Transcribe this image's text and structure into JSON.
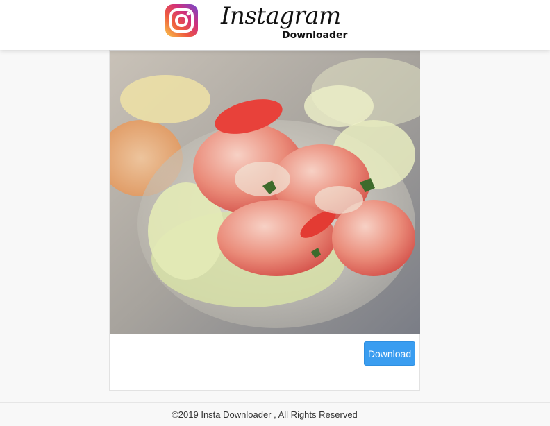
{
  "header": {
    "logo_icon": "instagram-camera-icon",
    "brand_title": "Instagram",
    "brand_subtitle": "Downloader"
  },
  "post": {
    "image_subject": "shrimp-cocktail-photo",
    "download_label": "Download"
  },
  "footer": {
    "copyright": "©2019 Insta Downloader , All Rights Reserved"
  },
  "colors": {
    "accent_button": "#3a9df0",
    "header_bg": "#ffffff",
    "page_bg": "#f8f8f8"
  }
}
